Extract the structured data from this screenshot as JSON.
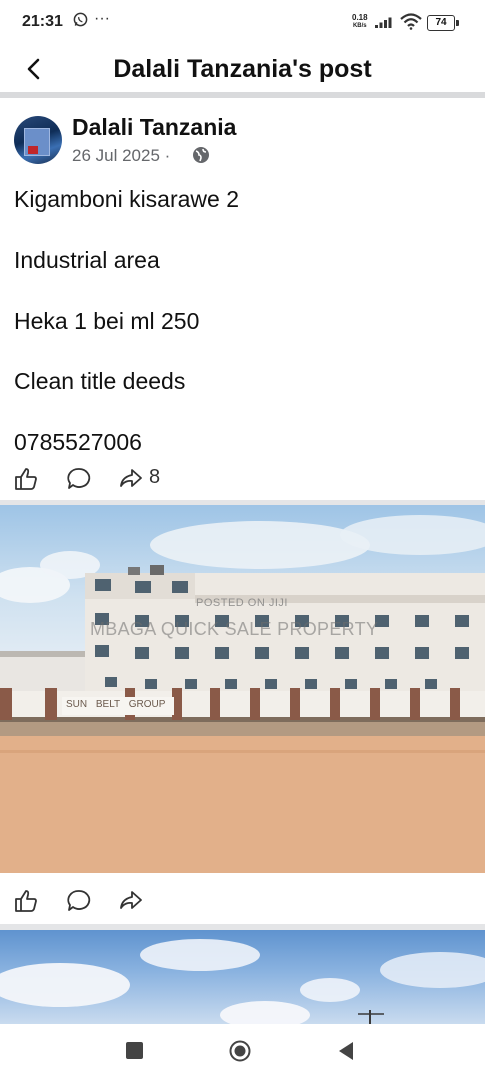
{
  "status_bar": {
    "time": "21:31",
    "notification_icon": "whatsapp-icon",
    "more": "···",
    "net_speed_value": "0.18",
    "net_speed_unit": "KB/s",
    "battery": "74"
  },
  "header": {
    "back_icon": "back-arrow-icon",
    "title": "Dalali Tanzania's post"
  },
  "post": {
    "author": "Dalali Tanzania",
    "date": "26 Jul 2025 ·",
    "privacy_icon": "globe-icon",
    "lines": [
      "Kigamboni kisarawe 2",
      "Industrial area",
      "Heka 1 bei ml 250",
      "Clean title deeds",
      "0785527006"
    ],
    "share_count": "8"
  },
  "photos": [
    {
      "watermark_small": "POSTED ON JIJI",
      "watermark": "MBAGA QUICK SALE PROPERTY",
      "sign": "SUN BELT GROUP"
    },
    {}
  ],
  "colors": {
    "divider": "#d9dadc",
    "secondary_text": "#65676b"
  },
  "navigation_bar": [
    "recent-apps-icon",
    "home-icon",
    "back-icon"
  ]
}
